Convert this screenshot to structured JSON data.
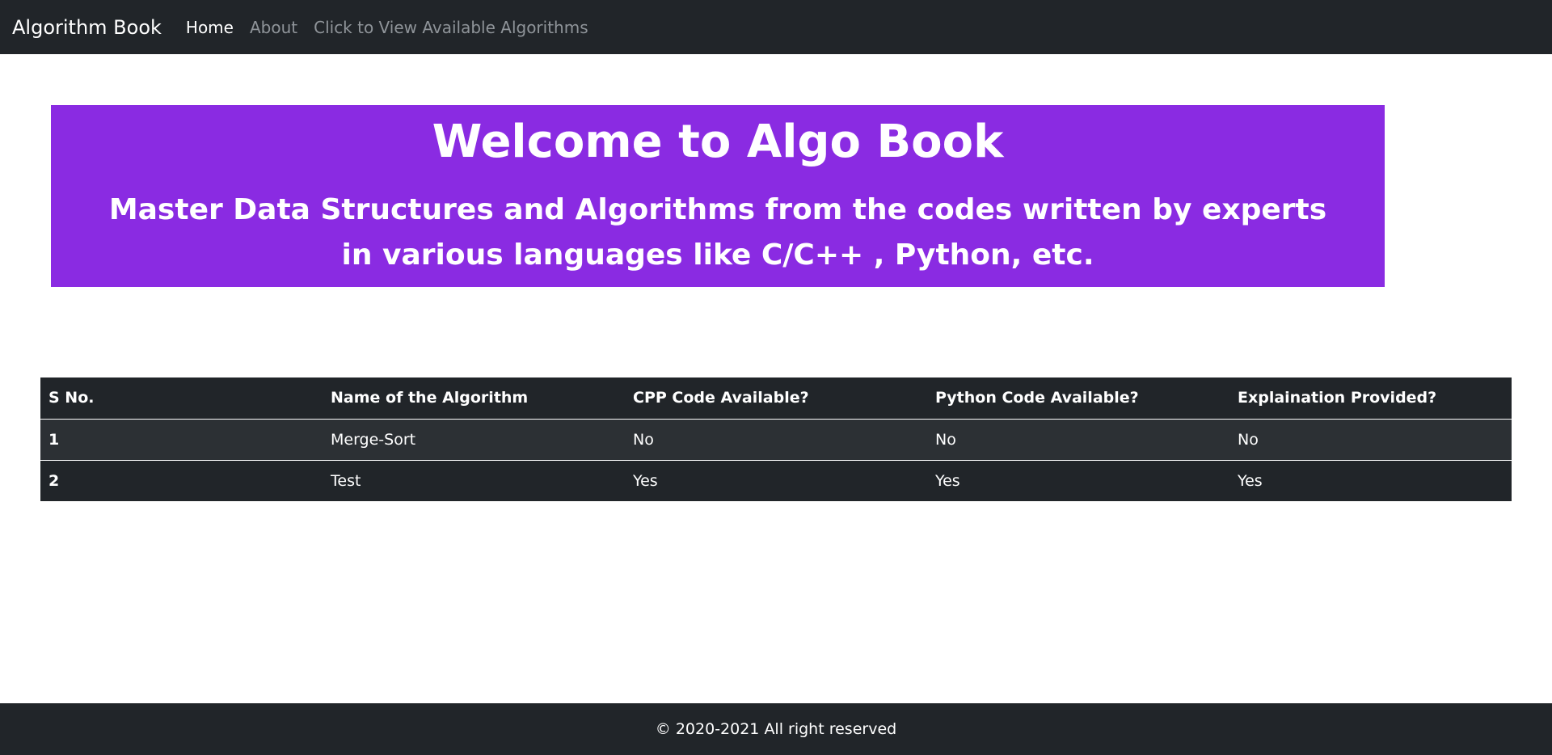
{
  "navbar": {
    "brand": "Algorithm Book",
    "links": [
      {
        "label": "Home"
      },
      {
        "label": "About"
      },
      {
        "label": "Click to View Available Algorithms"
      }
    ]
  },
  "hero": {
    "title": "Welcome to Algo Book",
    "subtitle": "Master Data Structures and Algorithms from the codes written by experts in various languages like C/C++ , Python, etc."
  },
  "table": {
    "headers": [
      "S No.",
      "Name of the Algorithm",
      "CPP Code Available?",
      "Python Code Available?",
      "Explaination Provided?"
    ],
    "rows": [
      [
        "1",
        "Merge-Sort",
        "No",
        "No",
        "No"
      ],
      [
        "2",
        "Test",
        "Yes",
        "Yes",
        "Yes"
      ]
    ]
  },
  "footer": {
    "text": "© 2020-2021 All right reserved"
  },
  "colors": {
    "navbar_bg": "#212529",
    "hero_bg": "#8a2be2",
    "table_row_striped": "#2c3034"
  }
}
